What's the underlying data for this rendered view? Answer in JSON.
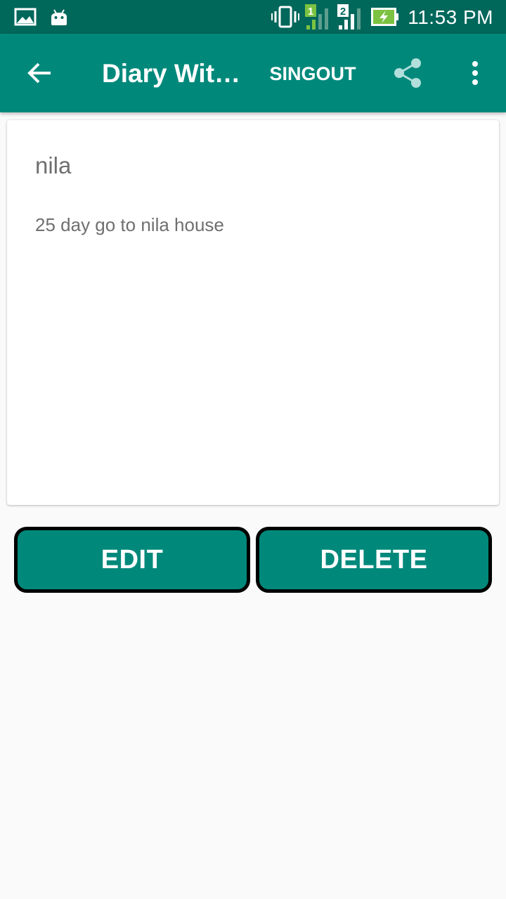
{
  "status_bar": {
    "time": "11:53 PM",
    "icons": [
      "gallery-icon",
      "android-icon",
      "vibrate-icon",
      "signal-sim1-icon",
      "signal-sim2-icon",
      "battery-charging-icon"
    ],
    "sim1_label": "1",
    "sim2_label": "2"
  },
  "app_bar": {
    "title": "Diary Wit…",
    "signout_label": "SINGOUT",
    "icons": [
      "back-arrow-icon",
      "share-icon",
      "more-vert-icon"
    ]
  },
  "note": {
    "title": "nila",
    "body": "25 day go to nila house"
  },
  "actions": {
    "edit_label": "EDIT",
    "delete_label": "DELETE"
  },
  "colors": {
    "status_bar": "#00675b",
    "primary": "#00897b",
    "background": "#fafafa",
    "text_secondary": "#6f6f6f"
  }
}
